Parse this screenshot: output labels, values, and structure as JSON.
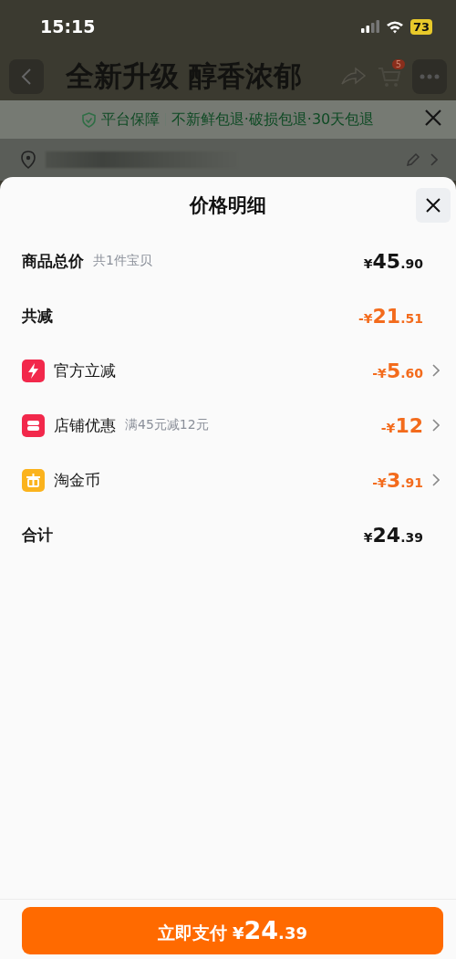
{
  "status_bar": {
    "time": "15:15",
    "battery": "73"
  },
  "product_page": {
    "banner": "全新升级 醇香浓郁",
    "cart_badge": "5",
    "guarantee": {
      "title": "平台保障",
      "terms": "不新鲜包退·破损包退·30天包退"
    }
  },
  "sheet": {
    "title": "价格明细",
    "rows": [
      {
        "kind": "line",
        "label": "商品总价",
        "note": "共1件宝贝",
        "amount": {
          "sign": "¥",
          "main": "45",
          "cents": ".90"
        }
      },
      {
        "kind": "reduction",
        "label": "共减",
        "amount": {
          "sign": "-¥",
          "main": "21",
          "cents": ".51"
        }
      },
      {
        "kind": "item",
        "label": "官方立减",
        "color": "#f2284b",
        "amount": {
          "sign": "-¥",
          "main": "5",
          "cents": ".60"
        }
      },
      {
        "kind": "item",
        "label": "店铺优惠",
        "note": "满45元减12元",
        "color": "#f2284b",
        "amount": {
          "sign": "-¥",
          "main": "12"
        }
      },
      {
        "kind": "item",
        "label": "淘金币",
        "color": "#fbb31d",
        "amount": {
          "sign": "-¥",
          "main": "3",
          "cents": ".91"
        }
      },
      {
        "kind": "line",
        "label": "合计",
        "amount": {
          "sign": "¥",
          "main": "24",
          "cents": ".39"
        }
      }
    ]
  },
  "pay_button": {
    "label": "立即支付",
    "amount": {
      "sign": "¥",
      "main": "24",
      "cents": ".39"
    }
  }
}
